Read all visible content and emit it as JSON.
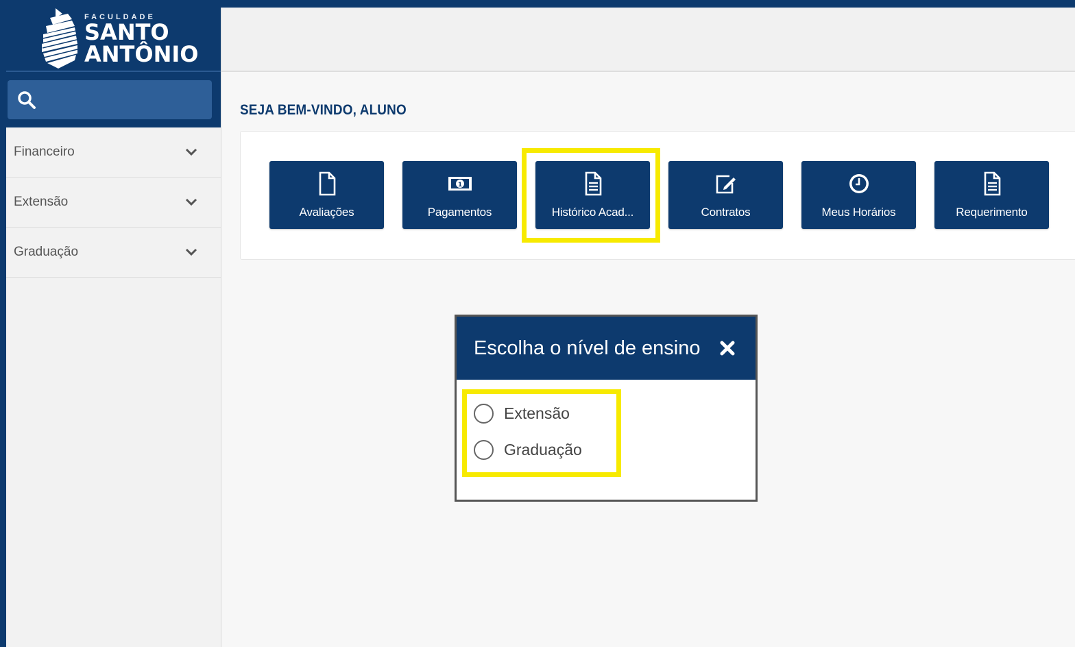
{
  "brand": {
    "small_text": "FACULDADE",
    "line1": "SANTO",
    "line2": "ANTÔNIO"
  },
  "search": {
    "icon": "search-icon"
  },
  "sidebar": {
    "items": [
      {
        "label": "Financeiro",
        "icon": "chevron-down-icon"
      },
      {
        "label": "Extensão",
        "icon": "chevron-down-icon"
      },
      {
        "label": "Graduação",
        "icon": "chevron-down-icon"
      }
    ]
  },
  "main": {
    "welcome": "SEJA BEM-VINDO, ALUNO",
    "tiles": [
      {
        "label": "Avaliações",
        "icon": "file-icon"
      },
      {
        "label": "Pagamentos",
        "icon": "money-icon"
      },
      {
        "label": "Histórico Acad...",
        "icon": "document-text-icon",
        "highlighted": true
      },
      {
        "label": "Contratos",
        "icon": "edit-icon"
      },
      {
        "label": "Meus Horários",
        "icon": "clock-icon"
      },
      {
        "label": "Requerimento",
        "icon": "document-text-icon"
      }
    ]
  },
  "modal": {
    "title": "Escolha o nível de ensino",
    "close_icon": "close-icon",
    "options": [
      {
        "label": "Extensão",
        "selected": false
      },
      {
        "label": "Graduação",
        "selected": false
      }
    ]
  },
  "colors": {
    "primary": "#0d3a6e",
    "highlight": "#f7ea00",
    "search_bg": "#2e5f98"
  }
}
